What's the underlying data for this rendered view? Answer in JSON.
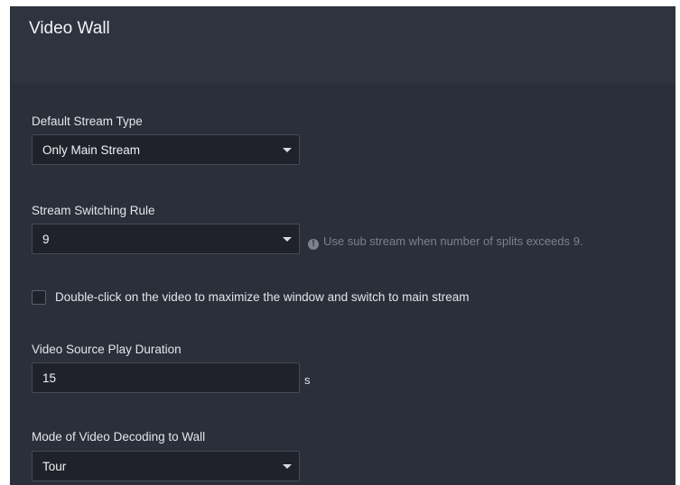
{
  "header": {
    "title": "Video Wall"
  },
  "default_stream_type": {
    "label": "Default Stream Type",
    "selected": "Only Main Stream"
  },
  "stream_switching_rule": {
    "label": "Stream Switching Rule",
    "selected": "9",
    "hint": "Use sub stream when number of splits exceeds 9."
  },
  "double_click_option": {
    "label": "Double-click on the video to maximize the window and switch to main stream",
    "checked": false
  },
  "video_source_play_duration": {
    "label": "Video Source Play Duration",
    "value": "15",
    "unit": "s"
  },
  "decoding_mode": {
    "label": "Mode of Video Decoding to Wall",
    "selected": "Tour"
  },
  "icons": {
    "dropdown": "chevron-down-icon",
    "info": "info-icon"
  },
  "colors": {
    "panel_bg": "#2b2f3a",
    "header_bg": "#2f333e",
    "field_bg": "#1f222a",
    "field_border": "#454a56",
    "hint_text": "#7c818c"
  }
}
